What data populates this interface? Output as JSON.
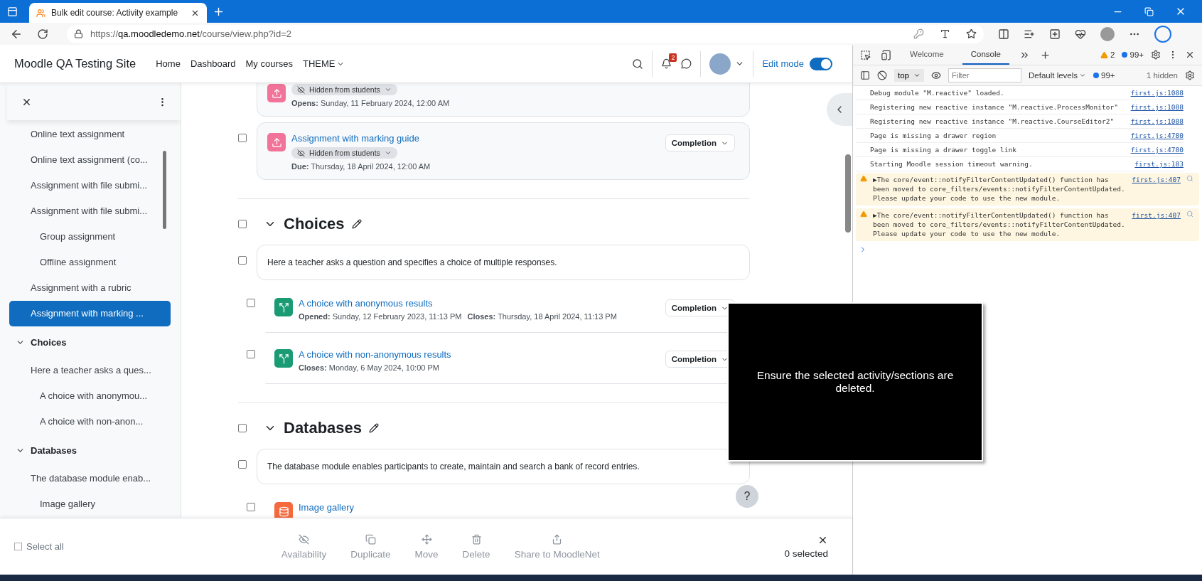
{
  "browser": {
    "tab": {
      "title": "Bulk edit course: Activity example"
    },
    "url": {
      "scheme": "https://",
      "host": "qa.moodledemo.net",
      "path": "/course/view.php?id=2"
    }
  },
  "navbar": {
    "brand": "Moodle QA Testing Site",
    "links": [
      {
        "label": "Home",
        "kind": "link"
      },
      {
        "label": "Dashboard",
        "kind": "link"
      },
      {
        "label": "My courses",
        "kind": "link"
      },
      {
        "label": "THEME",
        "kind": "menu"
      }
    ],
    "notifications": "2",
    "edit_mode": {
      "label": "Edit mode",
      "on": true
    }
  },
  "drawer": {
    "items": [
      {
        "label": "Online text assignment",
        "selected": false
      },
      {
        "label": "Online text assignment (co...",
        "selected": false
      },
      {
        "label": "Assignment with file submi...",
        "selected": false
      },
      {
        "label": "Assignment with file submi...",
        "selected": false,
        "children": [
          {
            "label": "Group assignment",
            "selected": false
          },
          {
            "label": "Offline assignment",
            "selected": false
          }
        ]
      },
      {
        "label": "Assignment with a rubric",
        "selected": false
      },
      {
        "label": "Assignment with marking ...",
        "selected": true
      }
    ],
    "sections": [
      {
        "title": "Choices",
        "expanded": true,
        "items": [
          {
            "label": "Here a teacher asks a ques...",
            "selected": false,
            "children": [
              {
                "label": "A choice with anonymou...",
                "selected": false
              },
              {
                "label": "A choice with non-anon...",
                "selected": false
              }
            ]
          }
        ]
      },
      {
        "title": "Databases",
        "expanded": true,
        "items": [
          {
            "label": "The database module enab...",
            "selected": false,
            "children": [
              {
                "label": "Image gallery",
                "selected": false
              }
            ]
          }
        ]
      }
    ]
  },
  "course": {
    "blocks": [
      {
        "kind": "assignment",
        "visibility": "Hidden from students",
        "dates": [
          {
            "label": "Opens:",
            "value": "Sunday, 11 February 2024, 12:00 AM"
          }
        ]
      },
      {
        "kind": "assignment",
        "name": "Assignment with marking guide",
        "visibility": "Hidden from students",
        "dates": [
          {
            "label": "Due:",
            "value": "Thursday, 18 April 2024, 12:00 AM"
          }
        ],
        "completion": "Completion",
        "checked": false
      },
      {
        "kind": "section",
        "title": "Choices",
        "expanded": true,
        "checked": false
      },
      {
        "kind": "summary",
        "text": "Here a teacher asks a question and specifies a choice of multiple responses.",
        "checked": false
      },
      {
        "kind": "choice",
        "name": "A choice with anonymous results",
        "dates": [
          {
            "label": "Opened:",
            "value": "Sunday, 12 February 2023, 11:13 PM"
          },
          {
            "label": "Closes:",
            "value": "Thursday, 18 April 2024, 11:13 PM"
          }
        ],
        "completion": "Completion",
        "checked": false
      },
      {
        "kind": "choice",
        "name": "A choice with non-anonymous results",
        "dates": [
          {
            "label": "Closes:",
            "value": "Monday, 6 May 2024, 10:00 PM"
          }
        ],
        "completion": "Completion",
        "checked": false
      },
      {
        "kind": "section",
        "title": "Databases",
        "expanded": true,
        "checked": false
      },
      {
        "kind": "summary",
        "text": "The database module enables participants to create, maintain and search a bank of record entries.",
        "checked": false
      },
      {
        "kind": "database",
        "name": "Image gallery",
        "checked": false
      }
    ]
  },
  "bulk_bar": {
    "select_all": {
      "label": "Select all",
      "checked": false
    },
    "actions": [
      {
        "label": "Availability",
        "disabled": true
      },
      {
        "label": "Duplicate",
        "disabled": true
      },
      {
        "label": "Move",
        "disabled": true
      },
      {
        "label": "Delete",
        "disabled": true
      },
      {
        "label": "Share to MoodleNet",
        "disabled": true
      }
    ],
    "count": "0 selected"
  },
  "help": "?",
  "toast": "Ensure the selected activity/sections are deleted.",
  "devtools": {
    "tabs": [
      {
        "label": "Welcome",
        "selected": false
      },
      {
        "label": "Console",
        "selected": true
      }
    ],
    "warnings": "2",
    "messages": "99+",
    "context": "top",
    "filter_placeholder": "Filter",
    "levels": "Default levels",
    "level_count": "99+",
    "hidden": "1 hidden",
    "console": [
      {
        "kind": "log",
        "text": "Debug module \"M.reactive\" loaded.",
        "source": "first.js:1088"
      },
      {
        "kind": "log",
        "text": "Registering new reactive instance \"M.reactive.ProcessMonitor\"",
        "source": "first.js:1088"
      },
      {
        "kind": "log",
        "text": "Registering new reactive instance \"M.reactive.CourseEditor2\"",
        "source": "first.js:1088"
      },
      {
        "kind": "log",
        "text": "Page is missing a drawer region",
        "source": "first.js:4780"
      },
      {
        "kind": "log",
        "text": "Page is missing a drawer toggle link",
        "source": "first.js:4780"
      },
      {
        "kind": "log",
        "text": "Starting Moodle session timeout warning.",
        "source": "first.js:183"
      },
      {
        "kind": "warning",
        "expander": "▶",
        "text": "The core/event::notifyFilterContentUpdated() function has been moved to core_filters/events::notifyFilterContentUpdated. Please update your code to use the new module.",
        "source": "first.js:407"
      },
      {
        "kind": "warning",
        "expander": "▶",
        "text": "The core/event::notifyFilterContentUpdated() function has been moved to core_filters/events::notifyFilterContentUpdated. Please update your code to use the new module.",
        "source": "first.js:407"
      }
    ]
  }
}
